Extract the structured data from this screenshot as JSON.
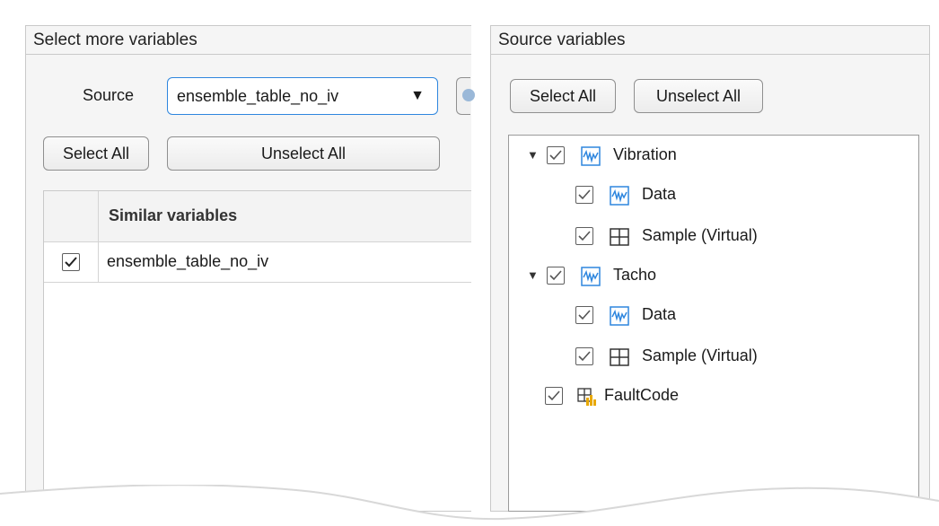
{
  "left_panel": {
    "title": "Select more variables",
    "source_label": "Source",
    "source_value": "ensemble_table_no_iv",
    "select_all": "Select All",
    "unselect_all": "Unselect All",
    "table": {
      "header": "Similar variables",
      "rows": [
        {
          "checked": true,
          "name": "ensemble_table_no_iv"
        }
      ]
    }
  },
  "right_panel": {
    "title": "Source variables",
    "select_all": "Select All",
    "unselect_all": "Unselect All",
    "tree": [
      {
        "label": "Vibration",
        "icon": "signal-icon",
        "checked": true,
        "expanded": true,
        "children": [
          {
            "label": "Data",
            "icon": "signal-icon",
            "checked": true
          },
          {
            "label": "Sample (Virtual)",
            "icon": "table-icon",
            "checked": true
          }
        ]
      },
      {
        "label": "Tacho",
        "icon": "signal-icon",
        "checked": true,
        "expanded": true,
        "children": [
          {
            "label": "Data",
            "icon": "signal-icon",
            "checked": true
          },
          {
            "label": "Sample (Virtual)",
            "icon": "table-icon",
            "checked": true
          }
        ]
      },
      {
        "label": "FaultCode",
        "icon": "categorical-icon",
        "checked": true
      }
    ]
  },
  "colors": {
    "accent": "#2e86de",
    "panel_bg": "#f5f5f5",
    "border": "#c9c9c9"
  }
}
